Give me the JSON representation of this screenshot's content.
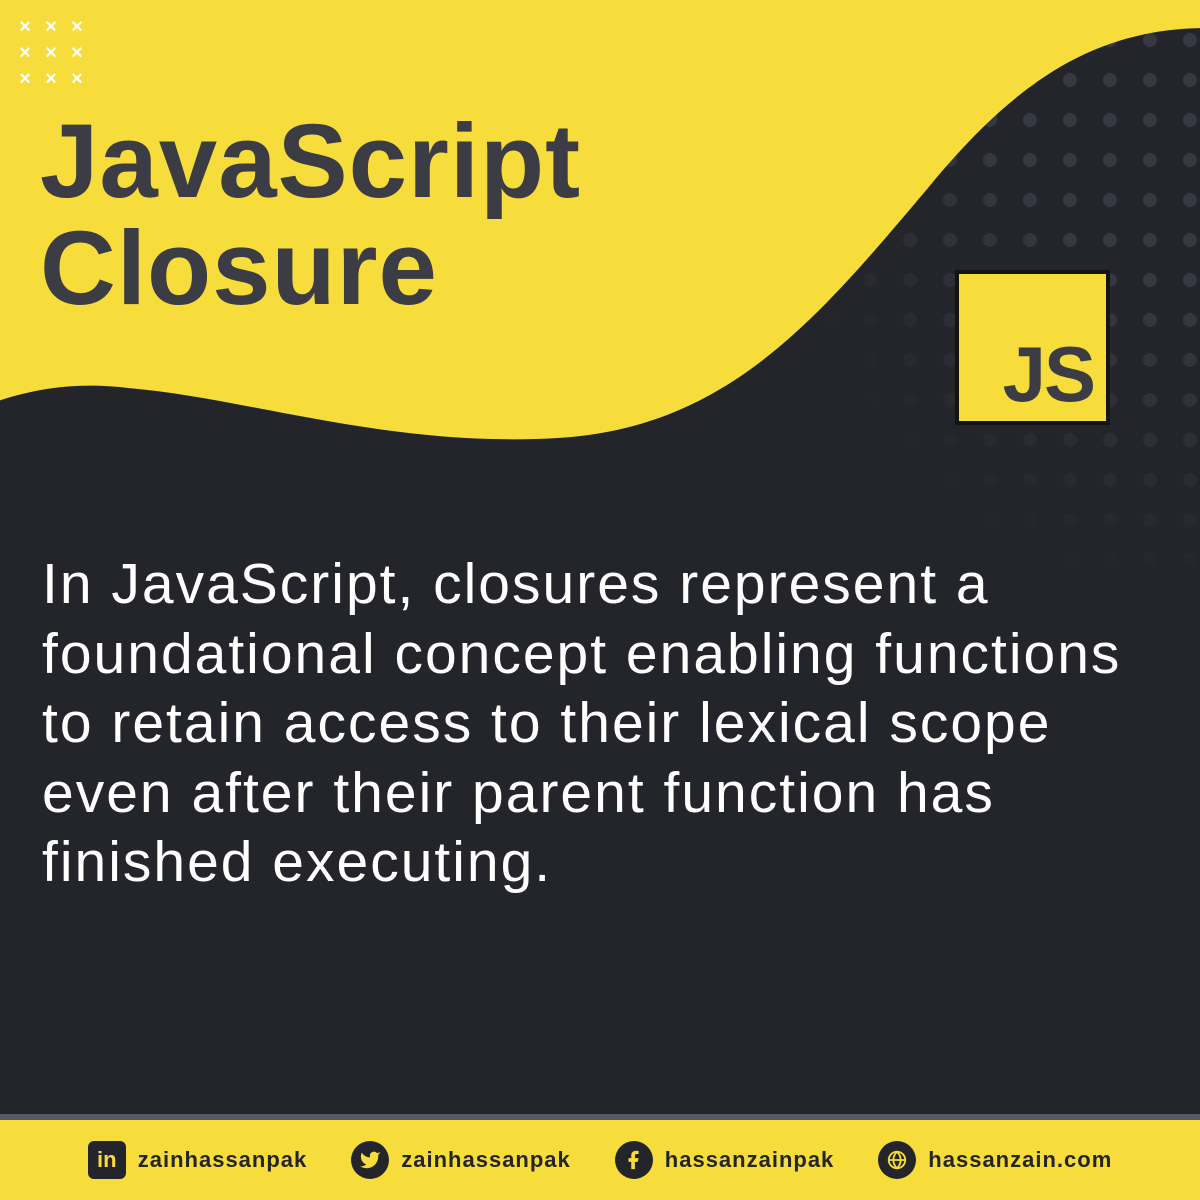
{
  "colors": {
    "bg": "#24252a",
    "accent": "#f6dd3b",
    "titleText": "#3b3c44",
    "bodyText": "#ffffff",
    "footerBorder": "#575863"
  },
  "title": {
    "line1": "JavaScript",
    "line2": "Closure"
  },
  "jsBadge": {
    "label": "JS"
  },
  "body": {
    "text": "In JavaScript, closures represent a foundational concept enabling functions to retain access to their lexical scope even after their parent function has finished executing."
  },
  "footer": {
    "items": [
      {
        "icon": "linkedin",
        "handle": "zainhassanpak"
      },
      {
        "icon": "twitter",
        "handle": "zainhassanPAK"
      },
      {
        "icon": "facebook",
        "handle": "hassanzainpak"
      },
      {
        "icon": "globe",
        "handle": "hassanzain.com"
      }
    ]
  }
}
